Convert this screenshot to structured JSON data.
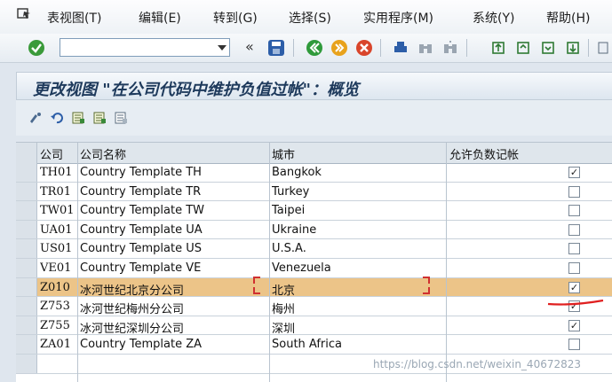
{
  "menu": {
    "items": [
      "表视图(T)",
      "编辑(E)",
      "转到(G)",
      "选择(S)",
      "实用程序(M)",
      "系统(Y)",
      "帮助(H)"
    ]
  },
  "toolbar": {
    "command_value": "",
    "prev_symbol": "«"
  },
  "screen": {
    "title": "更改视图 \"在公司代码中维护负值过帐\"：概览"
  },
  "table": {
    "headers": [
      "公司",
      "公司名称",
      "城市",
      "允许负数记帐"
    ],
    "rows": [
      {
        "code": "TH01",
        "name": "Country Template TH",
        "city": "Bangkok",
        "checked": true
      },
      {
        "code": "TR01",
        "name": "Country Template TR",
        "city": "Turkey",
        "checked": false
      },
      {
        "code": "TW01",
        "name": "Country Template TW",
        "city": "Taipei",
        "checked": false
      },
      {
        "code": "UA01",
        "name": "Country Template UA",
        "city": "Ukraine",
        "checked": false
      },
      {
        "code": "US01",
        "name": "Country Template US",
        "city": "U.S.A.",
        "checked": false
      },
      {
        "code": "VE01",
        "name": "Country Template VE",
        "city": "Venezuela",
        "checked": false
      },
      {
        "code": "Z010",
        "name": "冰河世纪北京分公司",
        "city": "北京",
        "checked": true
      },
      {
        "code": "Z753",
        "name": "冰河世纪梅州分公司",
        "city": "梅州",
        "checked": true
      },
      {
        "code": "Z755",
        "name": "冰河世纪深圳分公司",
        "city": "深圳",
        "checked": true
      },
      {
        "code": "ZA01",
        "name": "Country Template ZA",
        "city": "South Africa",
        "checked": false
      }
    ],
    "selected_index": 6,
    "check_mark": "✓"
  },
  "watermark": "https://blog.csdn.net/weixin_40672823",
  "colors": {
    "selected_row": "#ecc488",
    "annotation_red": "#e02020",
    "title_text": "#1e3a5c"
  }
}
